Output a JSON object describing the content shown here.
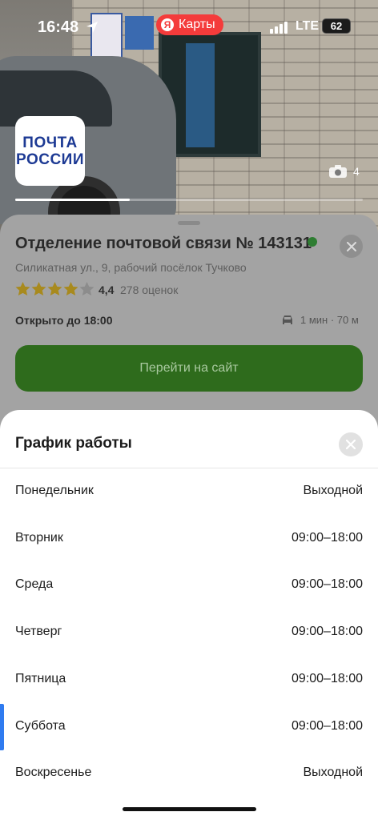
{
  "status_bar": {
    "time": "16:48",
    "app_pill": "Карты",
    "network": "LTE",
    "battery": "62"
  },
  "header": {
    "logo_lines": [
      "ПОЧТА",
      "РОССИИ"
    ],
    "photo_count": "4",
    "photo_progress": 0.33
  },
  "place": {
    "title": "Отделение почтовой связи № 143131",
    "address": "Силикатная ул., 9, рабочий посёлок Тучково",
    "rating": "4,4",
    "reviews": "278 оценок",
    "stars": 4,
    "open_status": "Открыто до 18:00",
    "route": "1 мин · 70 м",
    "site_button": "Перейти на сайт"
  },
  "schedule": {
    "title": "График работы",
    "rows": [
      {
        "day": "Понедельник",
        "hours": "Выходной"
      },
      {
        "day": "Вторник",
        "hours": "09:00–18:00"
      },
      {
        "day": "Среда",
        "hours": "09:00–18:00"
      },
      {
        "day": "Четверг",
        "hours": "09:00–18:00"
      },
      {
        "day": "Пятница",
        "hours": "09:00–18:00"
      },
      {
        "day": "Суббота",
        "hours": "09:00–18:00",
        "current": true
      },
      {
        "day": "Воскресенье",
        "hours": "Выходной"
      }
    ]
  },
  "colors": {
    "accent_green": "#2e6b1c",
    "today_marker": "#2f7bf0",
    "maps_red": "#f43b3b"
  }
}
